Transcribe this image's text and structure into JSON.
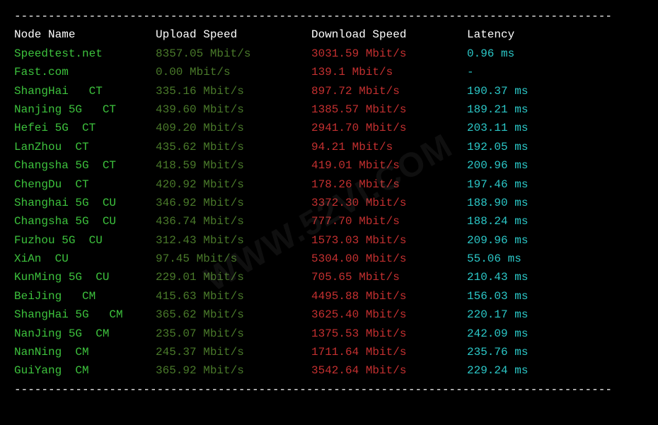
{
  "divider": "----------------------------------------------------------------------------------------",
  "headers": {
    "node": "Node Name",
    "upload": "Upload Speed",
    "download": "Download Speed",
    "latency": "Latency"
  },
  "watermark": "WWW.52VI.COM",
  "rows": [
    {
      "node": "Speedtest.net",
      "upload": "8357.05 Mbit/s",
      "download": "3031.59 Mbit/s",
      "latency": "0.96 ms"
    },
    {
      "node": "Fast.com",
      "upload": "0.00 Mbit/s",
      "download": "139.1 Mbit/s",
      "latency": "-"
    },
    {
      "node": "ShangHai   CT",
      "upload": "335.16 Mbit/s",
      "download": "897.72 Mbit/s",
      "latency": "190.37 ms"
    },
    {
      "node": "Nanjing 5G   CT",
      "upload": "439.60 Mbit/s",
      "download": "1385.57 Mbit/s",
      "latency": "189.21 ms"
    },
    {
      "node": "Hefei 5G  CT",
      "upload": "409.20 Mbit/s",
      "download": "2941.70 Mbit/s",
      "latency": "203.11 ms"
    },
    {
      "node": "LanZhou  CT",
      "upload": "435.62 Mbit/s",
      "download": "94.21 Mbit/s",
      "latency": "192.05 ms"
    },
    {
      "node": "Changsha 5G  CT",
      "upload": "418.59 Mbit/s",
      "download": "419.01 Mbit/s",
      "latency": "200.96 ms"
    },
    {
      "node": "ChengDu  CT",
      "upload": "420.92 Mbit/s",
      "download": "178.26 Mbit/s",
      "latency": "197.46 ms"
    },
    {
      "node": "Shanghai 5G  CU",
      "upload": "346.92 Mbit/s",
      "download": "3372.30 Mbit/s",
      "latency": "188.90 ms"
    },
    {
      "node": "Changsha 5G  CU",
      "upload": "436.74 Mbit/s",
      "download": "777.70 Mbit/s",
      "latency": "188.24 ms"
    },
    {
      "node": "Fuzhou 5G  CU",
      "upload": "312.43 Mbit/s",
      "download": "1573.03 Mbit/s",
      "latency": "209.96 ms"
    },
    {
      "node": "XiAn  CU",
      "upload": "97.45 Mbit/s",
      "download": "5304.00 Mbit/s",
      "latency": "55.06 ms"
    },
    {
      "node": "KunMing 5G  CU",
      "upload": "229.01 Mbit/s",
      "download": "705.65 Mbit/s",
      "latency": "210.43 ms"
    },
    {
      "node": "BeiJing   CM",
      "upload": "415.63 Mbit/s",
      "download": "4495.88 Mbit/s",
      "latency": "156.03 ms"
    },
    {
      "node": "ShangHai 5G   CM",
      "upload": "365.62 Mbit/s",
      "download": "3625.40 Mbit/s",
      "latency": "220.17 ms"
    },
    {
      "node": "NanJing 5G  CM",
      "upload": "235.07 Mbit/s",
      "download": "1375.53 Mbit/s",
      "latency": "242.09 ms"
    },
    {
      "node": "NanNing  CM",
      "upload": "245.37 Mbit/s",
      "download": "1711.64 Mbit/s",
      "latency": "235.76 ms"
    },
    {
      "node": "GuiYang  CM",
      "upload": "365.92 Mbit/s",
      "download": "3542.64 Mbit/s",
      "latency": "229.24 ms"
    }
  ]
}
